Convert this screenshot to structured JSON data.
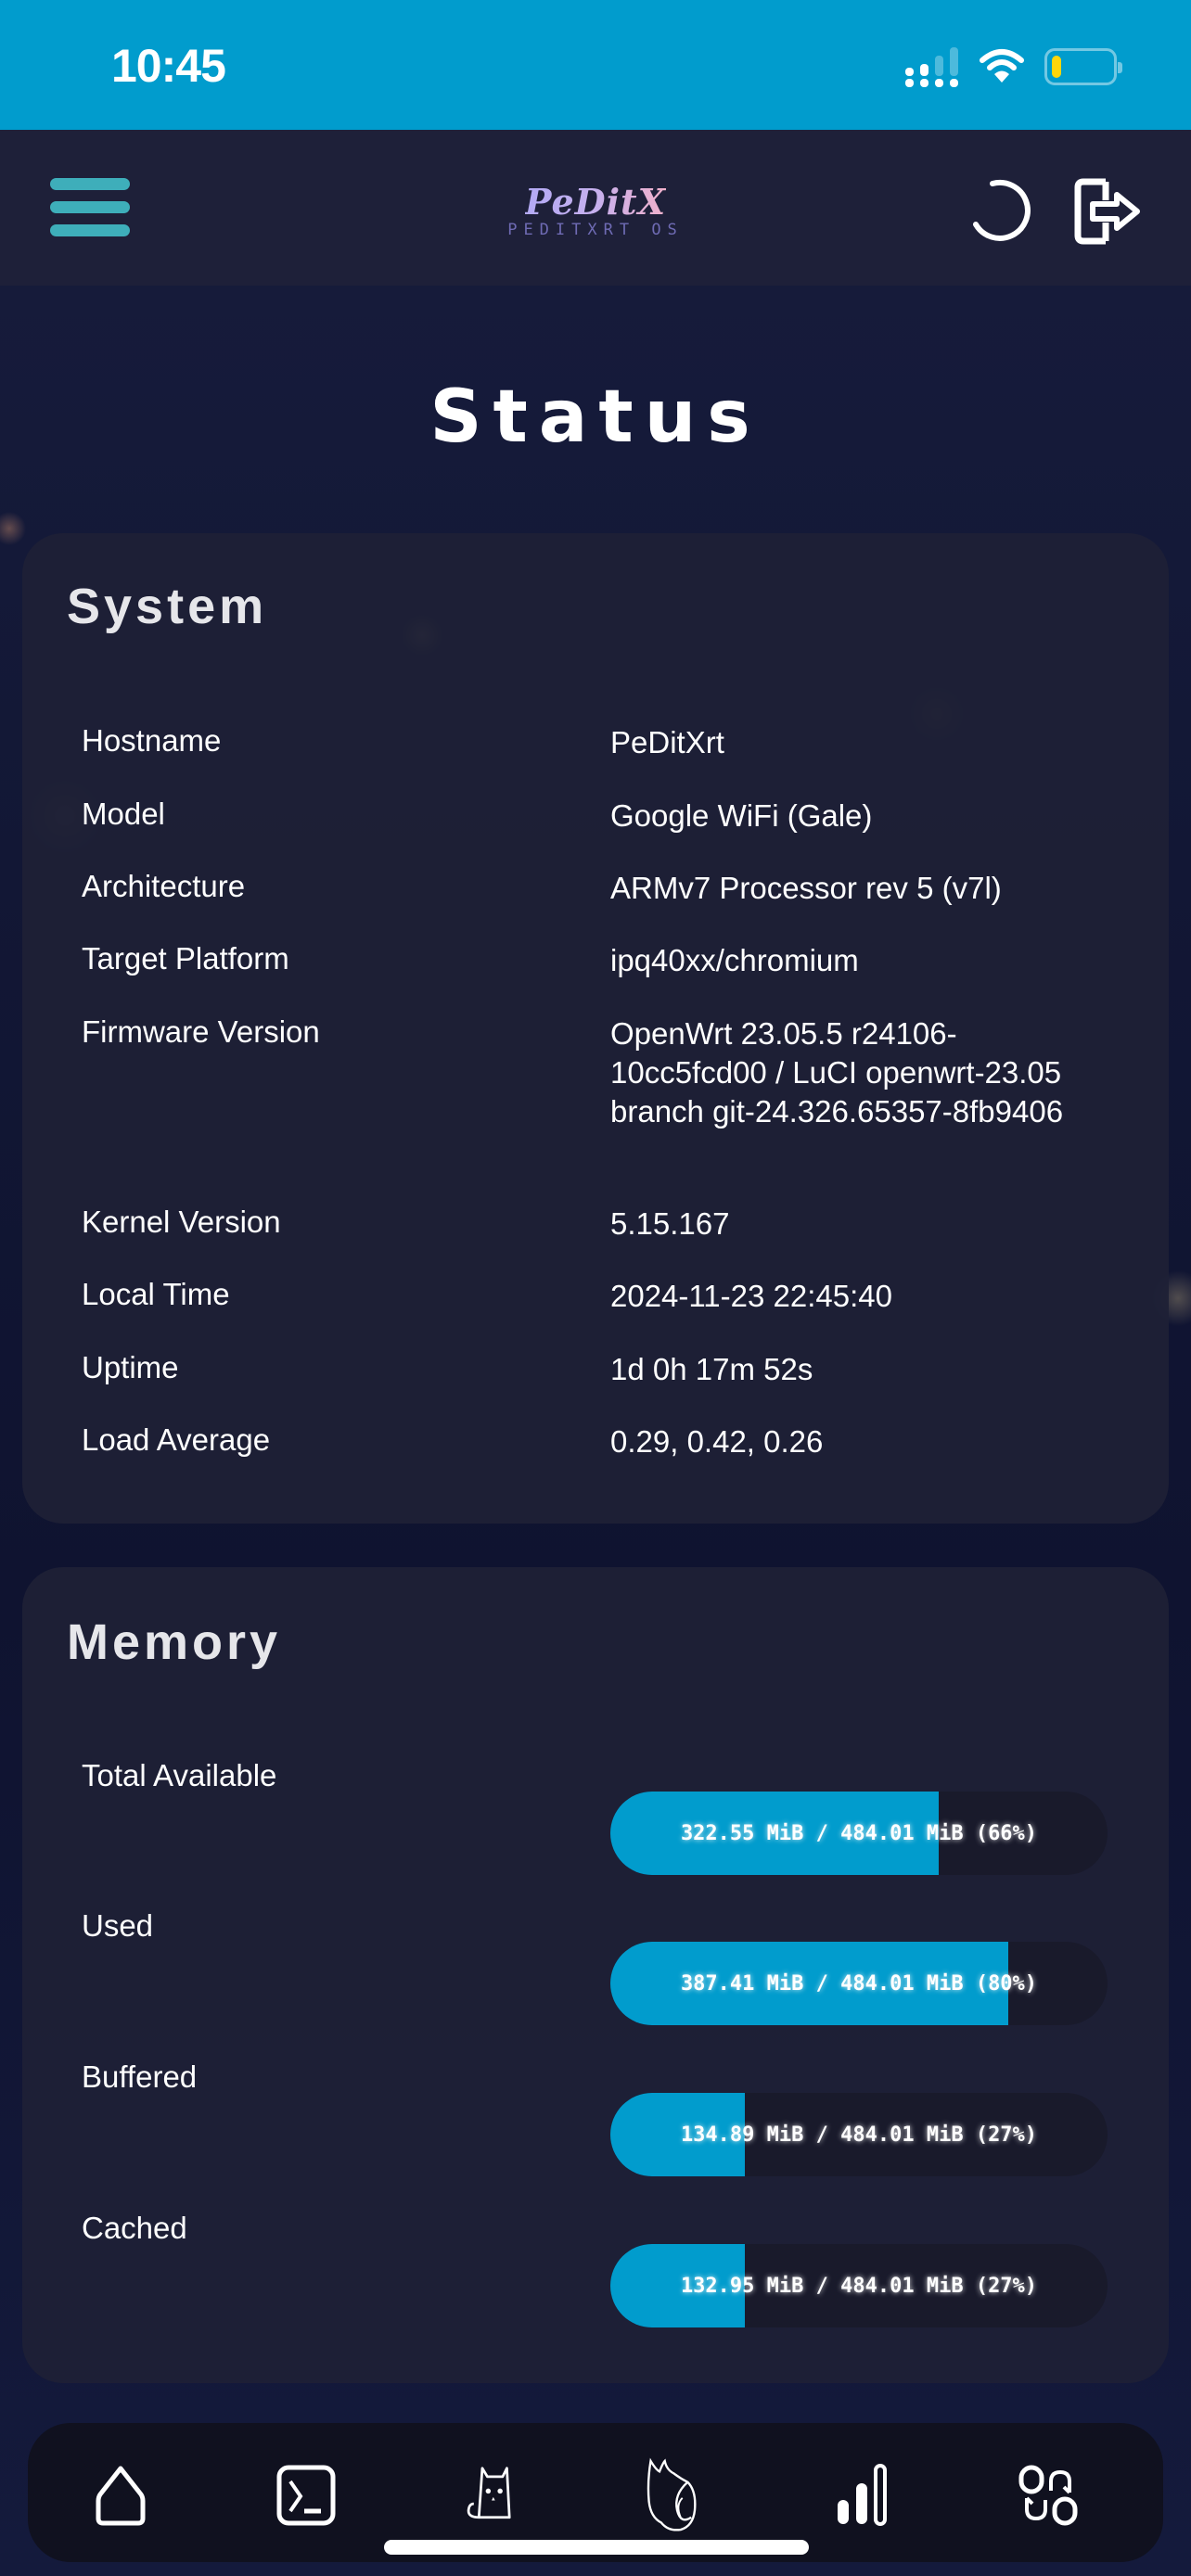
{
  "status_bar": {
    "time": "10:45",
    "icons": [
      "cellular-signal-icon",
      "wifi-icon",
      "battery-icon"
    ],
    "battery_level_percent": 15,
    "battery_color": "#ffd60a"
  },
  "header": {
    "logo_text": "PeDitX",
    "logo_subtitle": "PEDITXRT OS",
    "menu_icon": "hamburger-menu-icon",
    "refresh_icon": "refresh-icon",
    "logout_icon": "logout-icon"
  },
  "page": {
    "title": "Status"
  },
  "system": {
    "title": "System",
    "rows": [
      {
        "key": "Hostname",
        "value": "PeDitXrt"
      },
      {
        "key": "Model",
        "value": "Google WiFi (Gale)"
      },
      {
        "key": "Architecture",
        "value": "ARMv7 Processor rev 5 (v7l)"
      },
      {
        "key": "Target Platform",
        "value": "ipq40xx/chromium"
      },
      {
        "key": "Firmware Version",
        "value": "OpenWrt 23.05.5 r24106-10cc5fcd00 / LuCI openwrt-23.05 branch git-24.326.65357-8fb9406"
      },
      {
        "key": "Kernel Version",
        "value": "5.15.167"
      },
      {
        "key": "Local Time",
        "value": "2024-11-23 22:45:40"
      },
      {
        "key": "Uptime",
        "value": "1d 0h 17m 52s"
      },
      {
        "key": "Load Average",
        "value": "0.29, 0.42, 0.26"
      }
    ]
  },
  "memory": {
    "title": "Memory",
    "bar_color": "#019ccd",
    "rows": [
      {
        "key": "Total Available",
        "label": "322.55 MiB / 484.01 MiB (66%)",
        "percent": 66
      },
      {
        "key": "Used",
        "label": "387.41 MiB / 484.01 MiB (80%)",
        "percent": 80
      },
      {
        "key": "Buffered",
        "label": "134.89 MiB / 484.01 MiB (27%)",
        "percent": 27
      },
      {
        "key": "Cached",
        "label": "132.95 MiB / 484.01 MiB (27%)",
        "percent": 27
      }
    ]
  },
  "bottom_nav": {
    "items": [
      {
        "name": "home",
        "icon": "home-icon"
      },
      {
        "name": "terminal",
        "icon": "terminal-icon"
      },
      {
        "name": "cat",
        "icon": "cat-icon"
      },
      {
        "name": "fox",
        "icon": "fox-icon"
      },
      {
        "name": "stats",
        "icon": "bar-chart-icon"
      },
      {
        "name": "switch",
        "icon": "switch-icon"
      }
    ]
  }
}
